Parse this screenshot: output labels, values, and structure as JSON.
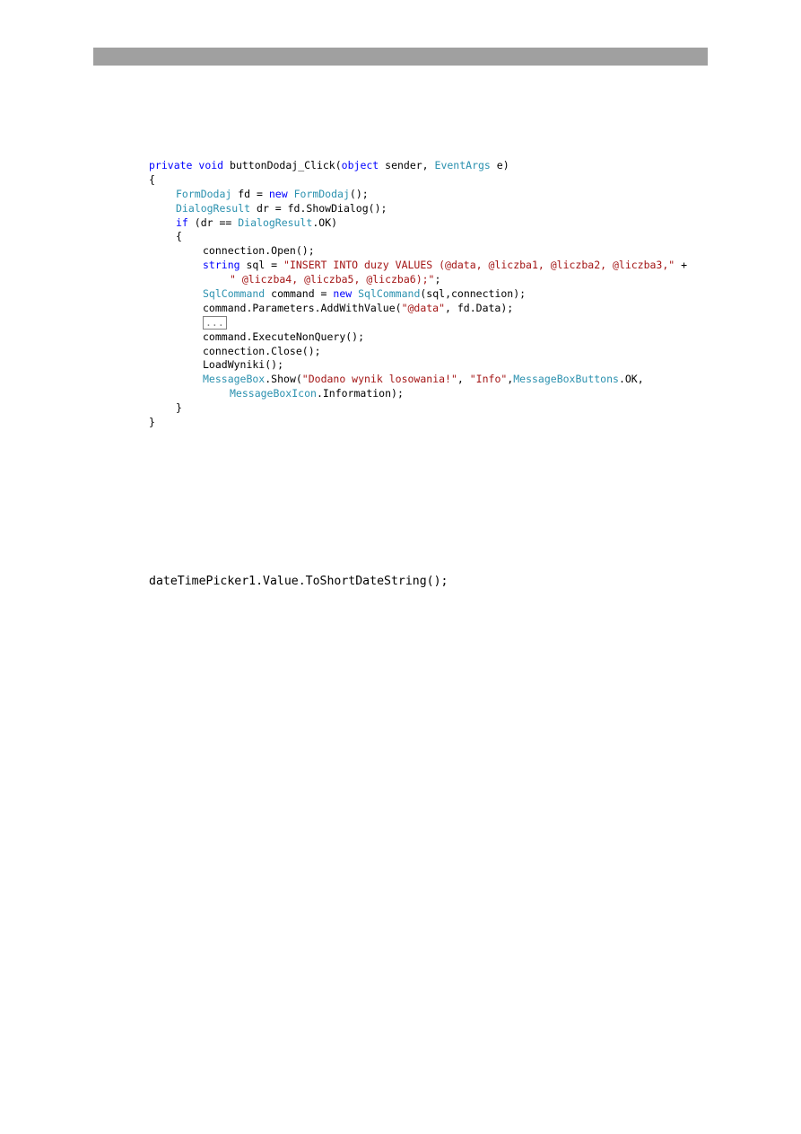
{
  "code": {
    "l1_kw1": "private",
    "l1_kw2": "void",
    "l1_name": " buttonDodaj_Click(",
    "l1_kw3": "object",
    "l1_mid": " sender, ",
    "l1_ty": "EventArgs",
    "l1_end": " e)",
    "l2": "{",
    "l3_ty1": "FormDodaj",
    "l3_mid": " fd = ",
    "l3_kw": "new",
    "l3_ty2": " FormDodaj",
    "l3_end": "();",
    "l4_ty": "DialogResult",
    "l4_end": " dr = fd.ShowDialog();",
    "l5_kw": "if",
    "l5_mid": " (dr == ",
    "l5_ty": "DialogResult",
    "l5_end": ".OK)",
    "l6": "{",
    "l7": "connection.Open();",
    "l8_kw": "string",
    "l8_mid": " sql = ",
    "l8_st": "\"INSERT INTO duzy VALUES (@data, @liczba1, @liczba2, @liczba3,\"",
    "l8_end": " +",
    "l9_st": "\" @liczba4, @liczba5, @liczba6);\"",
    "l9_end": ";",
    "l10_ty1": "SqlCommand",
    "l10_mid": " command = ",
    "l10_kw": "new",
    "l10_ty2": " SqlCommand",
    "l10_end": "(sql,connection);",
    "l11_start": "command.Parameters.AddWithValue(",
    "l11_st": "\"@data\"",
    "l11_end": ", fd.Data);",
    "l12_collapsed": "...",
    "l13": "command.ExecuteNonQuery();",
    "l14": "connection.Close();",
    "l15": "LoadWyniki();",
    "l16_ty": "MessageBox",
    "l16_mid": ".Show(",
    "l16_st1": "\"Dodano wynik losowania!\"",
    "l16_sep": ", ",
    "l16_st2": "\"Info\"",
    "l16_comma": ",",
    "l16_ty2": "MessageBoxButtons",
    "l16_end": ".OK,",
    "l17_ty": "MessageBoxIcon",
    "l17_end": ".Information);",
    "l18": "}",
    "l19": "}"
  },
  "snippet": "dateTimePicker1.Value.ToShortDateString();"
}
